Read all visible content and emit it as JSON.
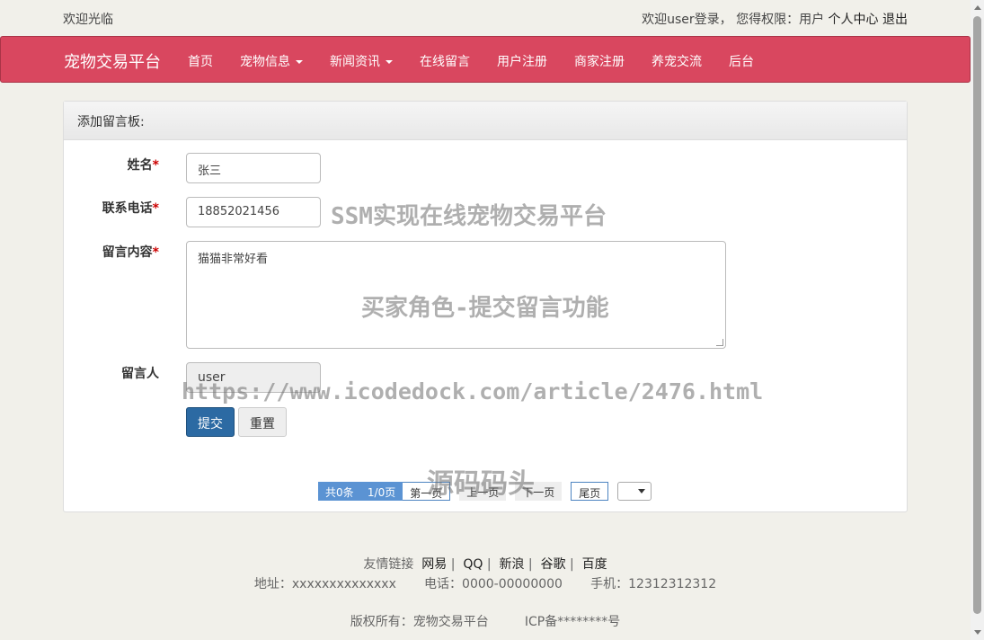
{
  "topbar": {
    "welcome": "欢迎光临",
    "login_status": "欢迎user登录，  您得权限：用户",
    "user_center": "个人中心",
    "logout": "退出"
  },
  "navbar": {
    "brand": "宠物交易平台",
    "items": [
      {
        "label": "首页",
        "dropdown": false
      },
      {
        "label": "宠物信息",
        "dropdown": true
      },
      {
        "label": "新闻资讯",
        "dropdown": true
      },
      {
        "label": "在线留言",
        "dropdown": false
      },
      {
        "label": "用户注册",
        "dropdown": false
      },
      {
        "label": "商家注册",
        "dropdown": false
      },
      {
        "label": "养宠交流",
        "dropdown": false
      },
      {
        "label": "后台",
        "dropdown": false
      }
    ],
    "accent_color": "#d9475f"
  },
  "form": {
    "heading": "添加留言板:",
    "name_label": "姓名",
    "name_value": "张三",
    "phone_label": "联系电话",
    "phone_value": "18852021456",
    "content_label": "留言内容",
    "content_value": "猫猫非常好看",
    "author_label": "留言人",
    "author_value": "user",
    "required_mark": "*",
    "submit": "提交",
    "reset": "重置"
  },
  "pager": {
    "total": "共0条",
    "pages": "1/0页",
    "first": "第一页",
    "prev": "上一页",
    "next": "下一页",
    "last": "尾页"
  },
  "watermarks": {
    "title": "SSM实现在线宠物交易平台",
    "subtitle": "买家角色-提交留言功能",
    "url": "https://www.icodedock.com/article/2476.html",
    "brand": "源码码头"
  },
  "footer": {
    "links_label": "友情链接",
    "links": [
      "网易",
      "QQ",
      "新浪",
      "谷歌",
      "百度"
    ],
    "separator": "|",
    "address": "地址：xxxxxxxxxxxxxx",
    "tel": "电话：0000-00000000",
    "mobile": "手机：12312312312",
    "copyright": "版权所有：宠物交易平台",
    "icp": "ICP备********号"
  }
}
